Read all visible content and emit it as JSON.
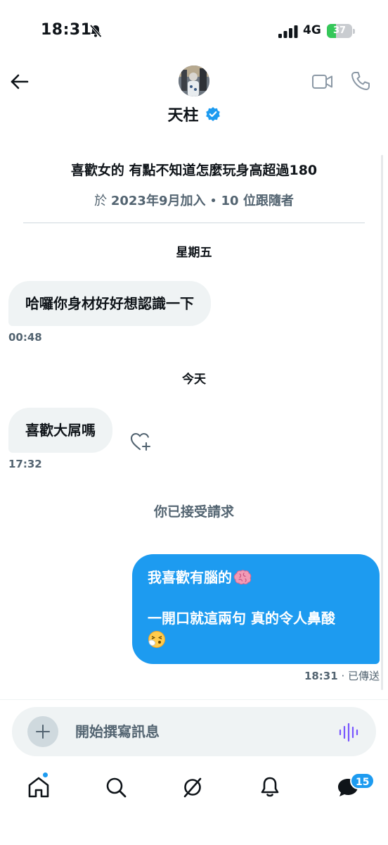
{
  "status_bar": {
    "time": "18:31",
    "network": "4G",
    "battery_text": "37",
    "battery_level": 0.37,
    "battery_color": "#35c759",
    "icons": [
      "bell-slash-icon",
      "signal-bars-icon"
    ]
  },
  "header": {
    "contact_name": "天柱",
    "verified": true,
    "icons": [
      "back-arrow-icon",
      "video-camera-icon",
      "phone-icon",
      "verified-badge-icon"
    ]
  },
  "profile": {
    "bio": "喜歡女的 有點不知道怎麼玩身高超過180",
    "joined_prefix": "於 ",
    "joined_date": "2023年9月加入",
    "followers_count": "10",
    "followers_label": " 位跟隨者"
  },
  "conversation": {
    "day1_label": "星期五",
    "msg1_text": "哈囉你身材好好想認識一下",
    "msg1_time": "00:48",
    "day2_label": "今天",
    "msg2_text": "喜歡大屌嗎",
    "msg2_time": "17:32",
    "system_note": "你已接受請求",
    "outgoing_line1": "我喜歡有腦的",
    "outgoing_line2": "一開口就這兩句 真的令人鼻酸",
    "outgoing_time": "18:31",
    "outgoing_status": " · 已傳送",
    "emoji": [
      "brain-emoji",
      "sneezing-face-emoji"
    ]
  },
  "composer": {
    "placeholder": "開始撰寫訊息",
    "icons": [
      "plus-icon",
      "voice-wave-icon"
    ]
  },
  "tab_bar": {
    "tabs": [
      "home",
      "search",
      "grok",
      "notifications",
      "messages"
    ],
    "messages_badge": "15",
    "accent": "#1d9bf0"
  }
}
